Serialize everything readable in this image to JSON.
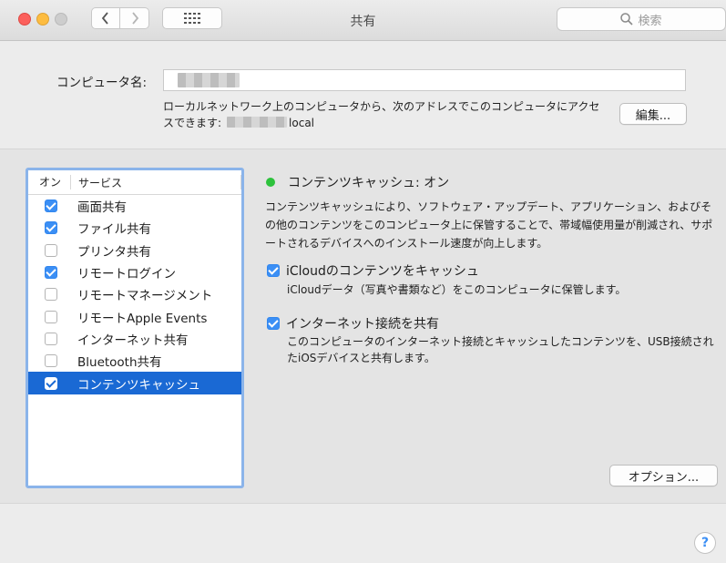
{
  "window": {
    "title": "共有",
    "search_placeholder": "検索"
  },
  "computer": {
    "name_label": "コンピュータ名:",
    "address_text": "ローカルネットワーク上のコンピュータから、次のアドレスでこのコンピュータにアクセスできます:",
    "address_suffix": "local",
    "edit_button": "編集..."
  },
  "services": {
    "header_on": "オン",
    "header_service": "サービス",
    "items": [
      {
        "label": "画面共有",
        "checked": true,
        "selected": false
      },
      {
        "label": "ファイル共有",
        "checked": true,
        "selected": false
      },
      {
        "label": "プリンタ共有",
        "checked": false,
        "selected": false
      },
      {
        "label": "リモートログイン",
        "checked": true,
        "selected": false
      },
      {
        "label": "リモートマネージメント",
        "checked": false,
        "selected": false
      },
      {
        "label": "リモートApple Events",
        "checked": false,
        "selected": false
      },
      {
        "label": "インターネット共有",
        "checked": false,
        "selected": false
      },
      {
        "label": "Bluetooth共有",
        "checked": false,
        "selected": false
      },
      {
        "label": "コンテンツキャッシュ",
        "checked": true,
        "selected": true
      }
    ]
  },
  "detail": {
    "status": "コンテンツキャッシュ: オン",
    "status_color": "#2dc23c",
    "description": "コンテンツキャッシュにより、ソフトウェア・アップデート、アプリケーション、およびその他のコンテンツをこのコンピュータ上に保管することで、帯域幅使用量が削減され、サポートされるデバイスへのインストール速度が向上します。",
    "option1_label": "iCloudのコンテンツをキャッシュ",
    "option1_desc": "iCloudデータ（写真や書類など）をこのコンピュータに保管します。",
    "option2_label": "インターネット接続を共有",
    "option2_desc": "このコンピュータのインターネット接続とキャッシュしたコンテンツを、USB接続されたiOSデバイスと共有します。",
    "options_button": "オプション..."
  },
  "help_label": "?"
}
